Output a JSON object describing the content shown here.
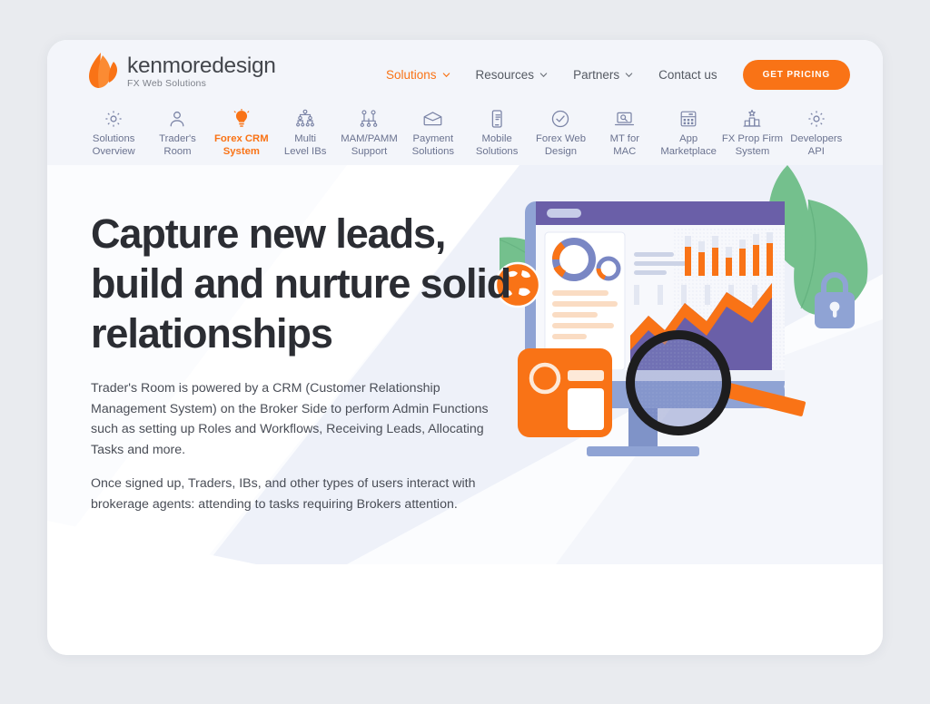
{
  "brand": {
    "logo_icon": "flame-leaf-logo",
    "name": "kenmoredesign",
    "tagline": "FX Web Solutions",
    "accent_color": "#f97316",
    "text_color": "#44474d"
  },
  "header": {
    "nav": [
      {
        "label": "Solutions",
        "has_caret": true,
        "active": true,
        "icon": "chevron-down-icon"
      },
      {
        "label": "Resources",
        "has_caret": true,
        "active": false,
        "icon": "chevron-down-icon"
      },
      {
        "label": "Partners",
        "has_caret": true,
        "active": false,
        "icon": "chevron-down-icon"
      },
      {
        "label": "Contact us",
        "has_caret": false,
        "active": false,
        "icon": ""
      }
    ],
    "cta": {
      "label": "GET PRICING",
      "color": "#f97316"
    }
  },
  "subnav": {
    "items": [
      {
        "label": "Solutions\nOverview",
        "icon": "gear-icon",
        "active": false
      },
      {
        "label": "Trader's\nRoom",
        "icon": "person-icon",
        "active": false
      },
      {
        "label": "Forex CRM\nSystem",
        "icon": "lightbulb-icon",
        "active": true
      },
      {
        "label": "Multi\nLevel IBs",
        "icon": "hierarchy-icon",
        "active": false
      },
      {
        "label": "MAM/PAMM\nSupport",
        "icon": "network-nodes-icon",
        "active": false
      },
      {
        "label": "Payment\nSolutions",
        "icon": "wallet-icon",
        "active": false
      },
      {
        "label": "Mobile\nSolutions",
        "icon": "mobile-phone-icon",
        "active": false
      },
      {
        "label": "Forex Web\nDesign",
        "icon": "check-circle-icon",
        "active": false
      },
      {
        "label": "MT for\nMAC",
        "icon": "laptop-icon",
        "active": false
      },
      {
        "label": "App\nMarketplace",
        "icon": "app-grid-icon",
        "active": false
      },
      {
        "label": "FX Prop Firm\nSystem",
        "icon": "podium-star-icon",
        "active": false
      },
      {
        "label": "Developers\nAPI",
        "icon": "gear-icon",
        "active": false
      }
    ]
  },
  "hero": {
    "title": "Capture new leads, build and nurture solid relationships",
    "paragraph_1": "Trader's Room is powered by a CRM (Customer Relationship Management System) on the Broker Side to perform Admin Functions such as setting up Roles and Workflows, Receiving Leads, Allocating Tasks and more.",
    "paragraph_2": "Once signed up, Traders, IBs, and other types of users interact with brokerage agents: attending to tasks requiring Brokers attention.",
    "illustration": {
      "name": "crm-dashboard-illustration",
      "elements": [
        "desktop-monitor",
        "donut-chart",
        "small-donut-chart",
        "bar-chart",
        "area-chart",
        "magnifying-glass",
        "padlock-icon",
        "globe-icon",
        "id-card-icon",
        "leaf-shapes"
      ],
      "colors": {
        "monitor_frame": "#8fa3d4",
        "monitor_titlebar": "#6a5fa8",
        "chart_orange": "#f97316",
        "chart_purple": "#6a5fa8",
        "leaf_green": "#74c08d",
        "lock_blue": "#8fa3d4"
      }
    }
  }
}
